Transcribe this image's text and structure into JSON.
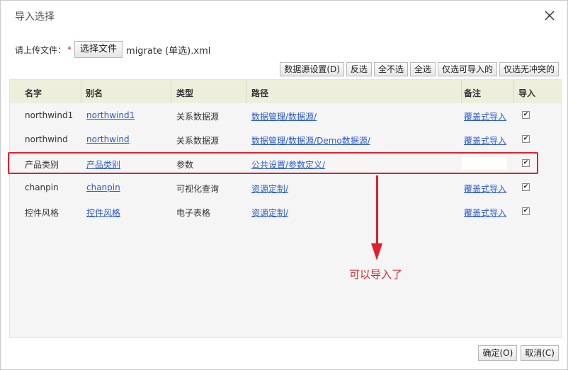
{
  "dialog": {
    "title": "导入选择",
    "close_icon": "close-icon"
  },
  "upload": {
    "label": "请上传文件：",
    "required_mark": "*",
    "file_button": "选择文件",
    "file_name": "migrate (单选).xml"
  },
  "toolbar": {
    "buttons": [
      "数据源设置(D)",
      "反选",
      "全不选",
      "全选",
      "仅选可导入的",
      "仅选无冲突的"
    ]
  },
  "table": {
    "headers": [
      "名字",
      "别名",
      "类型",
      "路径",
      "备注",
      "导入"
    ],
    "rows": [
      {
        "name": "northwind1",
        "alias": "northwind1",
        "type": "关系数据源",
        "path": "数据管理/数据源/",
        "note": "覆盖式导入",
        "import": true
      },
      {
        "name": "northwind",
        "alias": "northwind",
        "type": "关系数据源",
        "path": "数据管理/数据源/Demo数据源/",
        "note": "覆盖式导入",
        "import": true
      },
      {
        "name": "产品类别",
        "alias": "产品类别",
        "type": "参数",
        "path": "公共设置/参数定义/",
        "note": "",
        "import": true
      },
      {
        "name": "chanpin",
        "alias": "chanpin",
        "type": "可视化查询",
        "path": "资源定制/",
        "note": "覆盖式导入",
        "import": true
      },
      {
        "name": "控件风格",
        "alias": "控件风格",
        "type": "电子表格",
        "path": "资源定制/",
        "note": "覆盖式导入",
        "import": true
      }
    ]
  },
  "annotation": {
    "text": "可以导入了",
    "color": "#e0202a"
  },
  "footer": {
    "ok": "确定(O)",
    "cancel": "取消(C)"
  }
}
